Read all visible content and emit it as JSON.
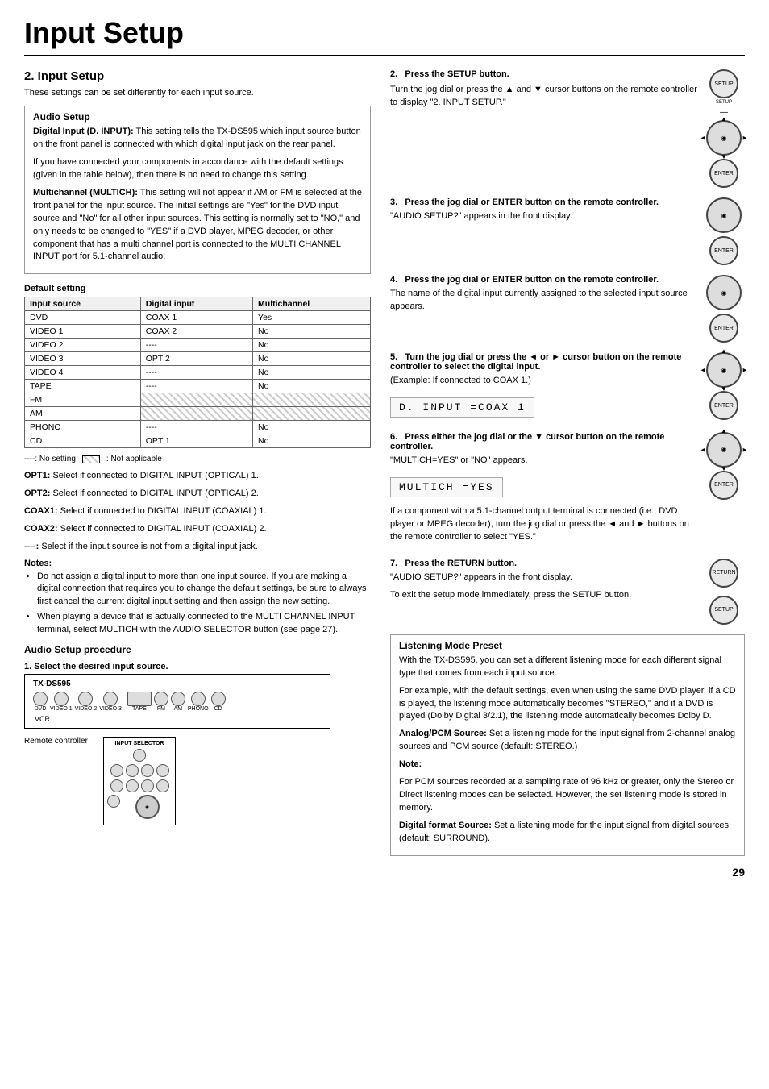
{
  "page": {
    "title": "Input Setup",
    "number": "29"
  },
  "section2": {
    "title": "2. Input Setup",
    "subtitle": "These settings can be set differently for each input source.",
    "audio_setup_box": {
      "title": "Audio Setup",
      "digital_input_label": "Digital Input (D. INPUT):",
      "digital_input_text": "This setting tells the TX-DS595 which input source button on the front panel is connected with which digital input jack on the rear panel.",
      "digital_input_text2": "If you have connected your components in accordance with the default settings (given in the table below), then there is no need to change this setting.",
      "multichannel_label": "Multichannel (MULTICH):",
      "multichannel_text": "This setting will not appear if AM or FM is selected at the front panel for the input source. The initial settings are \"Yes\" for the DVD input source and \"No\" for all other input sources. This setting is normally set to \"NO,\" and only needs to be changed to \"YES\" if a DVD player, MPEG decoder, or other component that has a multi channel port is connected to the MULTI CHANNEL INPUT port for 5.1-channel audio."
    },
    "default_setting": {
      "title": "Default setting",
      "headers": [
        "Input source",
        "Digital input",
        "Multichannel"
      ],
      "rows": [
        [
          "DVD",
          "COAX 1",
          "Yes"
        ],
        [
          "VIDEO 1",
          "COAX 2",
          "No"
        ],
        [
          "VIDEO 2",
          "----",
          "No"
        ],
        [
          "VIDEO 3",
          "OPT 2",
          "No"
        ],
        [
          "VIDEO 4",
          "----",
          "No"
        ],
        [
          "TAPE",
          "----",
          "No"
        ],
        [
          "FM",
          "",
          ""
        ],
        [
          "AM",
          "",
          ""
        ],
        [
          "PHONO",
          "----",
          "No"
        ],
        [
          "CD",
          "OPT 1",
          "No"
        ]
      ]
    },
    "legend_text": "----: No setting",
    "legend_box_label": ": Not applicable",
    "opt1_text": "OPT1: Select if connected to DIGITAL INPUT (OPTICAL) 1.",
    "opt2_text": "OPT2: Select if connected to DIGITAL INPUT (OPTICAL) 2.",
    "coax1_text": "COAX1: Select if connected to DIGITAL INPUT (COAXIAL) 1.",
    "coax2_text": "COAX2: Select if connected to DIGITAL INPUT (COAXIAL) 2.",
    "dash_text": "----: Select if the input source is not from a digital input jack.",
    "notes": {
      "title": "Notes:",
      "items": [
        "Do not assign a digital input to more than one input source. If you are making a digital connection that requires you to change the default settings, be sure to always first cancel the current digital input setting and then assign the new setting.",
        "When playing a device that is actually connected to the MULTI CHANNEL INPUT terminal, select MULTICH with the AUDIO SELECTOR button (see page 27)."
      ]
    }
  },
  "audio_setup_procedure": {
    "title": "Audio Setup procedure",
    "step1": {
      "number": "1.",
      "title": "Select the desired input source.",
      "device_label": "TX-DS595",
      "remote_label": "Remote controller"
    },
    "step2_right": {
      "number": "2.",
      "title": "Press the SETUP button.",
      "text": "Turn the jog dial or press the ▲ and ▼ cursor buttons on the remote controller to display \"2. INPUT SETUP.\""
    },
    "step3_right": {
      "number": "3.",
      "title": "Press the jog dial or ENTER button on the remote controller.",
      "text": "\"AUDIO SETUP?\" appears in the front display."
    },
    "step4_right": {
      "number": "4.",
      "title": "Press the jog dial or ENTER button on the remote controller.",
      "text": "The name of the digital input currently assigned to the selected input source appears."
    },
    "step5_right": {
      "number": "5.",
      "title": "Turn the jog dial or press the ◄ or ► cursor button on the remote controller to select the digital input.",
      "text": "(Example: If connected to COAX 1.)",
      "display": "D. INPUT  =COAX 1"
    },
    "step6_right": {
      "number": "6.",
      "title": "Press either the jog dial or the ▼ cursor button on the remote controller.",
      "text": "\"MULTICH=YES\" or \"NO\" appears.",
      "display": "MULTICH   =YES",
      "extra_text": "If a component with a 5.1-channel output terminal is connected (i.e., DVD player or MPEG decoder), turn the jog dial or press the ◄ and ► buttons on the remote controller to select \"YES.\""
    },
    "step7_right": {
      "number": "7.",
      "title": "Press the RETURN button.",
      "text1": "\"AUDIO SETUP?\" appears in the front display.",
      "text2": "To exit the setup mode immediately, press the SETUP button."
    }
  },
  "listening_mode_preset": {
    "title": "Listening Mode Preset",
    "text1": "With the TX-DS595, you can set a different listening mode for each different signal type that comes from each input source.",
    "text2": "For example, with the default settings, even when using the same DVD player, if a CD is played, the listening mode automatically becomes \"STEREO,\" and if a DVD is played (Dolby Digital 3/2.1), the listening mode automatically becomes Dolby D.",
    "analog_label": "Analog/PCM Source:",
    "analog_text": "Set a listening mode for the input signal from 2-channel analog sources and PCM source (default: STEREO.)",
    "note_title": "Note:",
    "note_text": "For PCM sources recorded at a sampling rate of 96 kHz or greater, only the Stereo or Direct listening modes can be selected. However, the set listening mode is stored in memory.",
    "digital_label": "Digital format Source:",
    "digital_text": "Set a listening mode for the input signal from digital sources (default: SURROUND)."
  }
}
